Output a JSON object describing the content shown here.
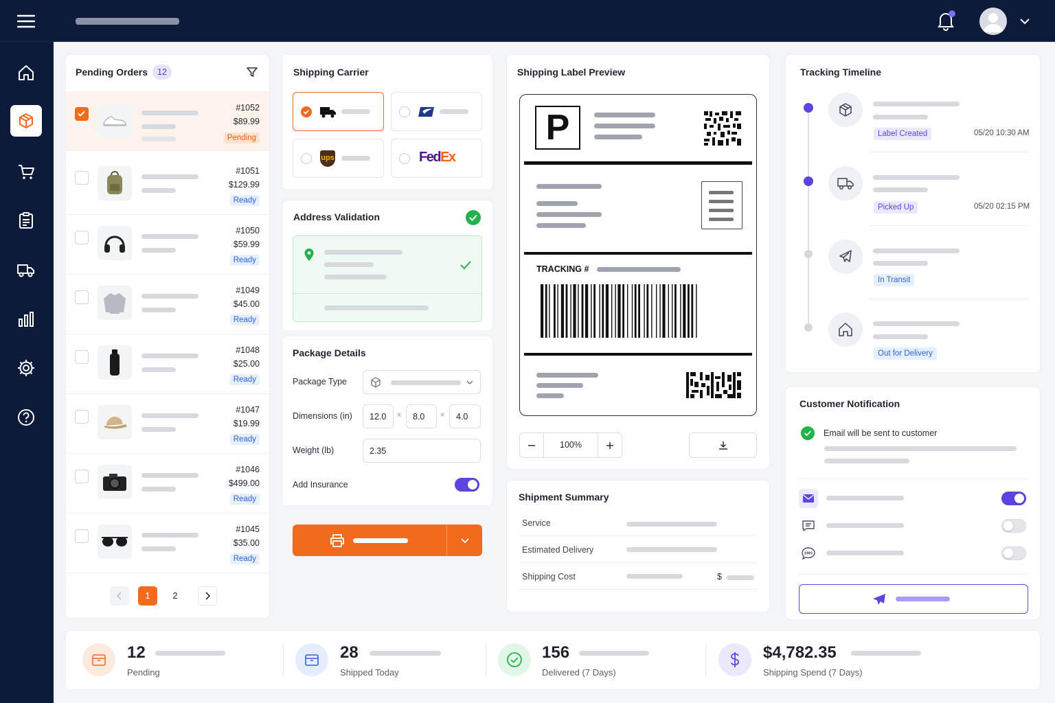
{
  "orders": {
    "title": "Pending Orders",
    "count": "12",
    "items": [
      {
        "id": "#1052",
        "price": "$89.99",
        "status": "Pending"
      },
      {
        "id": "#1051",
        "price": "$129.99",
        "status": "Ready"
      },
      {
        "id": "#1050",
        "price": "$59.99",
        "status": "Ready"
      },
      {
        "id": "#1049",
        "price": "$45.00",
        "status": "Ready"
      },
      {
        "id": "#1048",
        "price": "$25.00",
        "status": "Ready"
      },
      {
        "id": "#1047",
        "price": "$19.99",
        "status": "Ready"
      },
      {
        "id": "#1046",
        "price": "$499.00",
        "status": "Ready"
      },
      {
        "id": "#1045",
        "price": "$35.00",
        "status": "Ready"
      }
    ],
    "pagination": {
      "page1": "1",
      "page2": "2"
    }
  },
  "carrier": {
    "title": "Shipping Carrier",
    "fedex_label": "FedEx",
    "ups_label": "ups"
  },
  "address": {
    "title": "Address Validation"
  },
  "package": {
    "title": "Package Details",
    "type_label": "Package Type",
    "dims_label": "Dimensions (in)",
    "dim_l": "12.0",
    "dim_w": "8.0",
    "dim_h": "4.0",
    "times": "×",
    "weight_label": "Weight (lb)",
    "weight": "2.35",
    "insurance_label": "Add Insurance",
    "insurance_on": true
  },
  "label": {
    "title": "Shipping Label Preview",
    "service_letter": "P",
    "tracking_label": "TRACKING #",
    "zoom": "100%"
  },
  "summary": {
    "title": "Shipment Summary",
    "rows": [
      "Service",
      "Estimated Delivery",
      "Shipping Cost"
    ],
    "currency": "$"
  },
  "timeline": {
    "title": "Tracking Timeline",
    "events": [
      {
        "status": "Label Created",
        "time": "05/20 10:30 AM"
      },
      {
        "status": "Picked Up",
        "time": "05/20 02:15 PM"
      },
      {
        "status": "In Transit",
        "time": ""
      },
      {
        "status": "Out for Delivery",
        "time": ""
      }
    ]
  },
  "notification": {
    "title": "Customer Notification",
    "email_msg": "Email will be sent to customer",
    "channels": [
      {
        "icon": "mail-icon",
        "on": true
      },
      {
        "icon": "chat-icon",
        "on": false
      },
      {
        "icon": "sms-icon",
        "on": false
      }
    ],
    "sms_glyph": "SMS"
  },
  "kpis": [
    {
      "value": "12",
      "label": "Pending"
    },
    {
      "value": "28",
      "label": "Shipped Today"
    },
    {
      "value": "156",
      "label": "Delivered (7 Days)"
    },
    {
      "value": "$4,782.35",
      "label": "Shipping Spend (7 Days)"
    }
  ],
  "colors": {
    "navy": "#0e1a3a",
    "orange": "#f26b1d",
    "purple": "#5b45e0",
    "green": "#22b34c",
    "blue": "#2d64d8"
  }
}
